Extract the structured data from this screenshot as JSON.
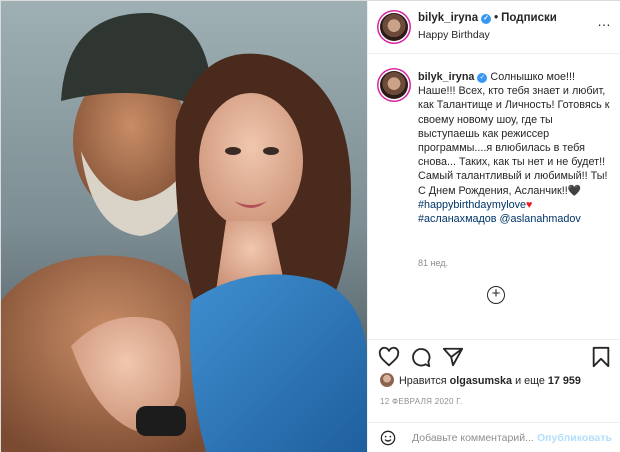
{
  "header": {
    "username": "bilyk_iryna",
    "verified_mark": "✓",
    "separator": "•",
    "follow_label": "Подписки",
    "subtitle": "Happy Birthday",
    "more_icon": "…"
  },
  "caption": {
    "username": "bilyk_iryna",
    "verified_mark": "✓",
    "text_1": "Солнышко мое!!! Наше!!! Всех, кто тебя знает и любит, как Талантище и Личность! Готовясь к своему новому шоу, где ты выступаешь как режиссер программы....я влюбилась в тебя снова... Таких, как ты нет и не будет!! Самый талантливый и любимый!! Ты! С Днем Рождения, Асланчик!!",
    "black_heart": "🖤",
    "hashtag_1": "#happybirthdaymylove",
    "red_heart": "♥",
    "hashtag_2": "#асланахмадов",
    "mention": "@aslanahmadov",
    "time_ago": "81 нед.",
    "load_more_glyph": "+"
  },
  "actions": {
    "like_icon": "heart-outline-icon",
    "comment_icon": "comment-icon",
    "share_icon": "share-icon",
    "save_icon": "bookmark-icon"
  },
  "likes": {
    "prefix": "Нравится",
    "first_liker": "olgasumska",
    "connector": "и еще",
    "count": "17 959"
  },
  "date": "12 ФЕВРАЛЯ 2020 Г.",
  "comment_box": {
    "placeholder": "Добавьте комментарий...",
    "publish_label": "Опубликовать"
  },
  "colors": {
    "verified": "#3897f0",
    "tag": "#003569",
    "publish": "#b2dffc",
    "heart": "#ed1c24"
  }
}
